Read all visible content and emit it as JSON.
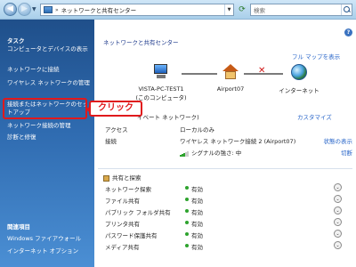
{
  "address": {
    "breadcrumb_sep": "»",
    "location": "ネットワークと共有センター",
    "search_placeholder": "検索"
  },
  "left": {
    "tasks_header": "タスク",
    "tasks": [
      "コンピュータとデバイスの表示",
      "ネットワークに接続",
      "ワイヤレス ネットワークの管理",
      "接続またはネットワークのセットアップ",
      "ネットワーク接続の管理",
      "診断と修復"
    ],
    "related_header": "関連項目",
    "related": [
      "Windows ファイアウォール",
      "インターネット オプション"
    ]
  },
  "main": {
    "title": "ネットワークと共有センター",
    "fullmap": "フル マップを表示",
    "nodes": {
      "pc": "VISTA-PC-TEST1\n(このコンピュータ)",
      "router": "Airport07",
      "internet": "インターネット"
    },
    "network_name": "イベート ネットワーク)",
    "customize": "カスタマイズ",
    "rows": [
      {
        "k": "アクセス",
        "v": "ローカルのみ",
        "a": ""
      },
      {
        "k": "接続",
        "v": "ワイヤレス ネットワーク接続 2 (Airport07)",
        "a": "状態の表示"
      },
      {
        "k": "",
        "v": "シグナルの強さ: 中",
        "a": "切断"
      }
    ],
    "sharing_header": "共有と探索",
    "sharing": [
      {
        "k": "ネットワーク探索",
        "v": "有効"
      },
      {
        "k": "ファイル共有",
        "v": "有効"
      },
      {
        "k": "パブリック フォルダ共有",
        "v": "有効"
      },
      {
        "k": "プリンタ共有",
        "v": "有効"
      },
      {
        "k": "パスワード保護共有",
        "v": "有効"
      },
      {
        "k": "メディア共有",
        "v": "有効"
      }
    ],
    "click_label": "クリック"
  },
  "colors": {
    "accent": "#2966c9",
    "highlight": "#e0191c",
    "enabled_dot": "#2ea32e"
  }
}
